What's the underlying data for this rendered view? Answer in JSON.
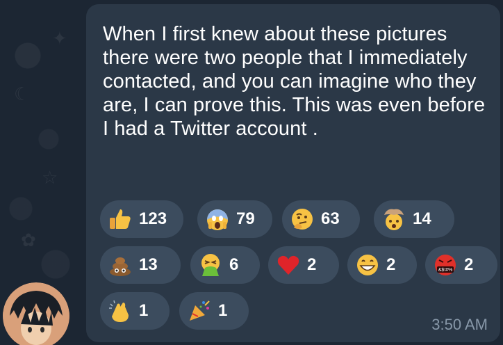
{
  "message": {
    "text": "When I first knew about these pictures there were two people that I immediately contacted, and you can imagine who they are, I can prove this. This was even before I had a Twitter account .",
    "time": "3:50 AM"
  },
  "reactions": [
    {
      "emoji": "thumbs-up",
      "count": "123"
    },
    {
      "emoji": "screaming-face",
      "count": "79"
    },
    {
      "emoji": "thinking-face",
      "count": "63"
    },
    {
      "emoji": "exploding-head",
      "count": "14"
    },
    {
      "emoji": "pile-of-poo",
      "count": "13"
    },
    {
      "emoji": "vomiting-face",
      "count": "6"
    },
    {
      "emoji": "red-heart",
      "count": "2"
    },
    {
      "emoji": "grinning-face",
      "count": "2"
    },
    {
      "emoji": "face-with-symbols",
      "count": "2",
      "symbols": "&$!#%"
    },
    {
      "emoji": "clapping-hands",
      "count": "1"
    },
    {
      "emoji": "party-popper",
      "count": "1"
    }
  ],
  "colors": {
    "background": "#1c2633",
    "bubble": "#2b3847",
    "reaction_pill": "#3c4c5e",
    "timestamp": "#8797a8"
  }
}
